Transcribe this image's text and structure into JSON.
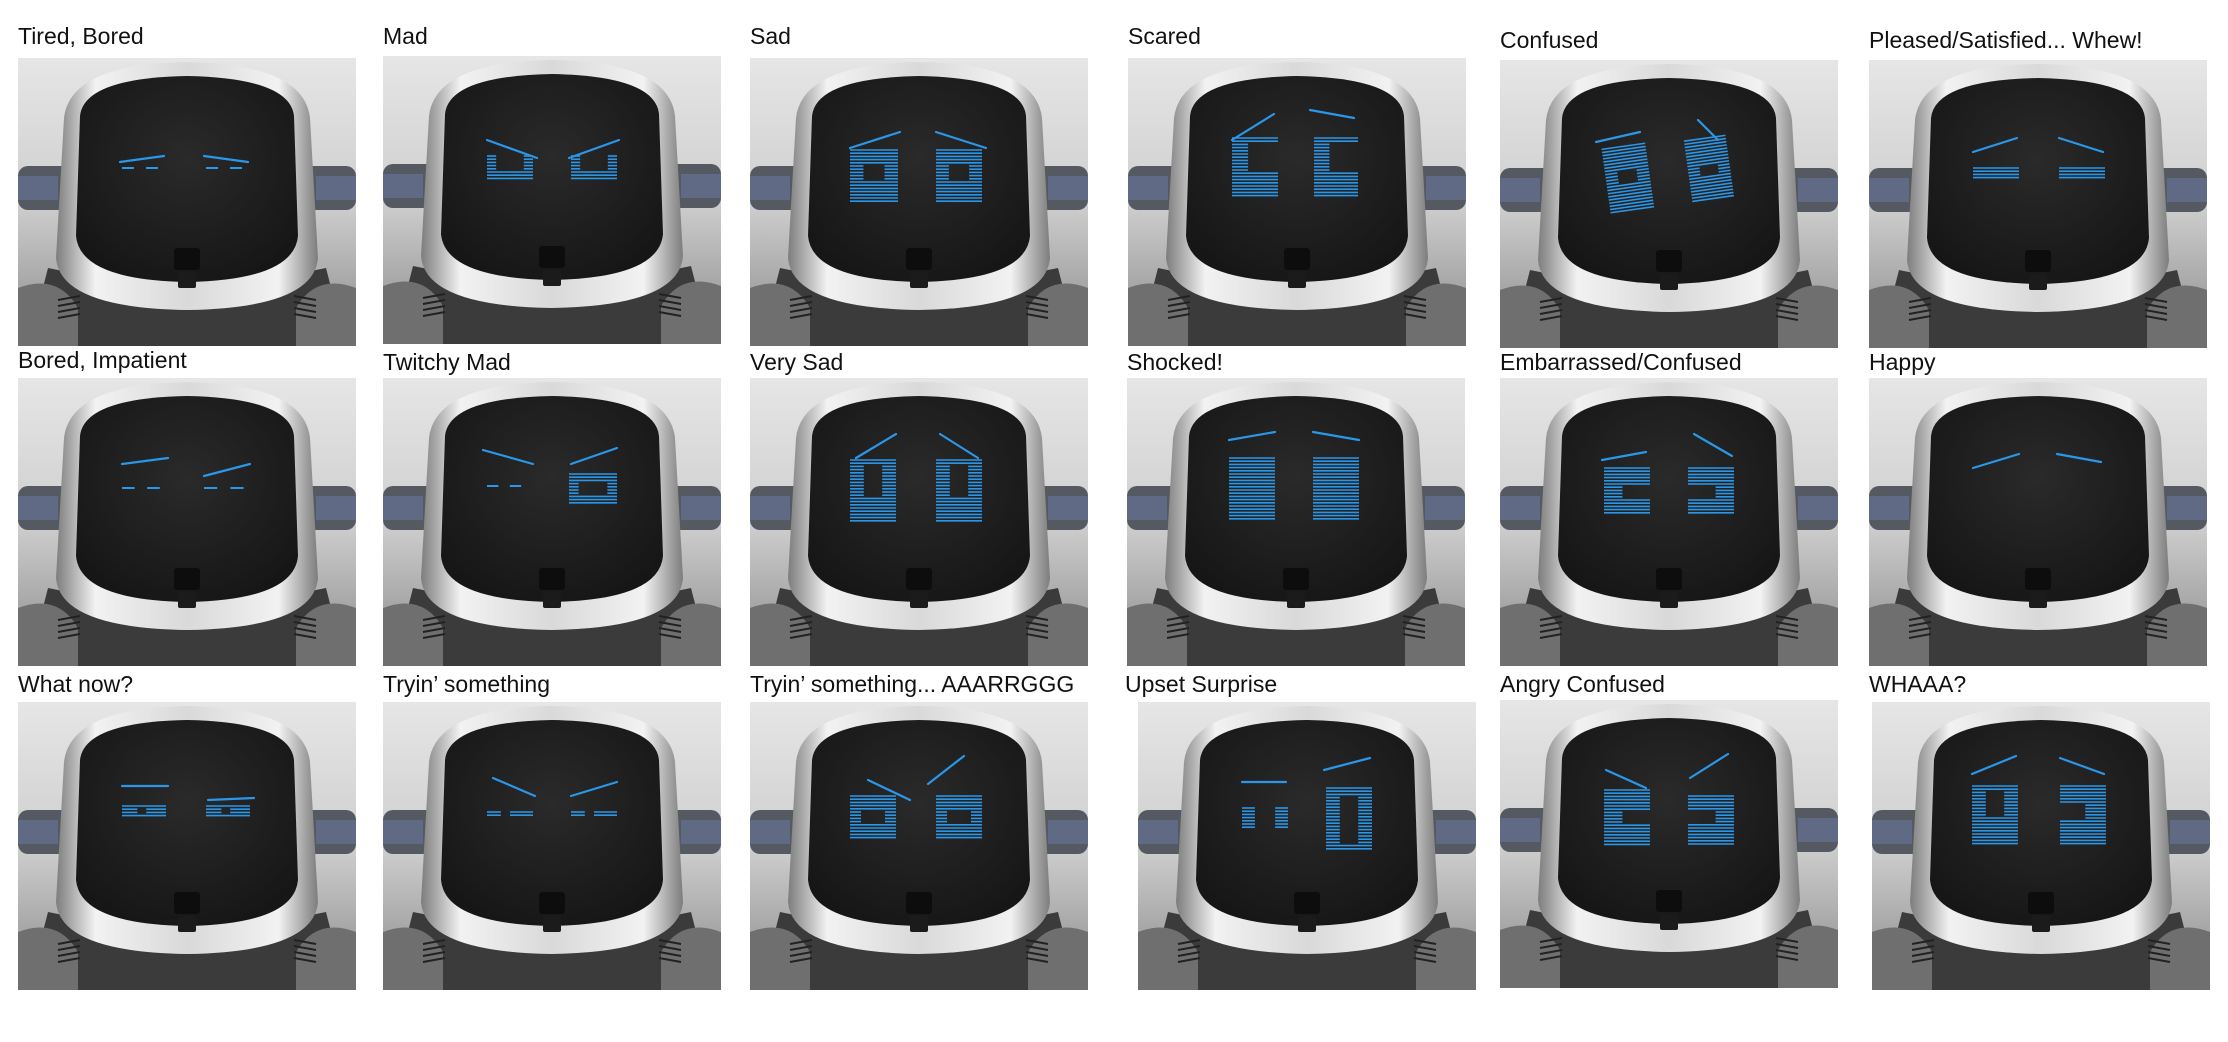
{
  "accent_color": "#2b97e8",
  "panels": [
    {
      "label": "Tired, Bored",
      "expression": "tired-bored"
    },
    {
      "label": "Mad",
      "expression": "mad"
    },
    {
      "label": "Sad",
      "expression": "sad"
    },
    {
      "label": "Scared",
      "expression": "scared"
    },
    {
      "label": "Confused",
      "expression": "confused"
    },
    {
      "label": "Pleased/Satisfied... Whew!",
      "expression": "pleased-satisfied"
    },
    {
      "label": "Bored, Impatient",
      "expression": "bored-impatient"
    },
    {
      "label": "Twitchy Mad",
      "expression": "twitchy-mad"
    },
    {
      "label": "Very Sad",
      "expression": "very-sad"
    },
    {
      "label": "Shocked!",
      "expression": "shocked"
    },
    {
      "label": "Embarrassed/Confused",
      "expression": "embarrassed-confused"
    },
    {
      "label": "Happy",
      "expression": "happy"
    },
    {
      "label": "What now?",
      "expression": "what-now"
    },
    {
      "label": "Tryin’ something",
      "expression": "tryin-something"
    },
    {
      "label": "Tryin’ something... AAARRGGG",
      "expression": "tryin-something-aaarrggg"
    },
    {
      "label": "Upset Surprise",
      "expression": "upset-surprise"
    },
    {
      "label": "Angry Confused",
      "expression": "angry-confused"
    },
    {
      "label": "WHAAA?",
      "expression": "whaaa"
    }
  ]
}
